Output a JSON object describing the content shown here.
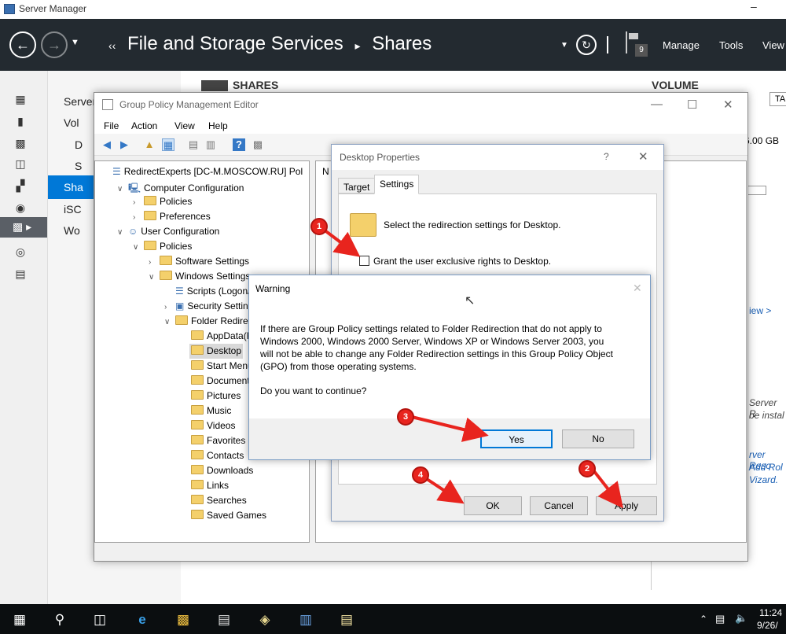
{
  "server_manager": {
    "title": "Server Manager",
    "breadcrumb": [
      "File and Storage Services",
      "Shares"
    ],
    "notification_count": "9",
    "menu": {
      "manage": "Manage",
      "tools": "Tools",
      "view": "View"
    },
    "nav_items": [
      "Server",
      "Vol",
      "D",
      "S",
      "Sha",
      "iSC",
      "Wo"
    ],
    "shares_heading": "SHARES",
    "volume_heading": "VOLUME",
    "volume_tab_label": "TA",
    "volume_size": "6.00 GB",
    "view_link": "iew >",
    "side_text_lines": [
      "Server R",
      "be instal",
      "rver Reso",
      "Add Rol",
      "Vizard."
    ]
  },
  "gpme": {
    "title": "Group Policy Management Editor",
    "menu": [
      "File",
      "Action",
      "View",
      "Help"
    ],
    "right_pane_header": "N",
    "tree": [
      {
        "label": "RedirectExperts [DC-M.MOSCOW.RU] Pol",
        "indent": 0,
        "exp": "",
        "icon": "gpo"
      },
      {
        "label": "Computer Configuration",
        "indent": 1,
        "exp": "v",
        "icon": "computer"
      },
      {
        "label": "Policies",
        "indent": 2,
        "exp": ">",
        "icon": "folder"
      },
      {
        "label": "Preferences",
        "indent": 2,
        "exp": ">",
        "icon": "folder"
      },
      {
        "label": "User Configuration",
        "indent": 1,
        "exp": "v",
        "icon": "user"
      },
      {
        "label": "Policies",
        "indent": 2,
        "exp": "v",
        "icon": "folder"
      },
      {
        "label": "Software Settings",
        "indent": 3,
        "exp": ">",
        "icon": "folder"
      },
      {
        "label": "Windows Settings",
        "indent": 3,
        "exp": "v",
        "icon": "folder"
      },
      {
        "label": "Scripts (Logon/",
        "indent": 4,
        "exp": "",
        "icon": "script"
      },
      {
        "label": "Security Setting",
        "indent": 4,
        "exp": ">",
        "icon": "security"
      },
      {
        "label": "Folder Redirecti",
        "indent": 4,
        "exp": "v",
        "icon": "folder"
      },
      {
        "label": "AppData(Ro",
        "indent": 5,
        "exp": "",
        "icon": "folder"
      },
      {
        "label": "Desktop",
        "indent": 5,
        "exp": "",
        "icon": "folder",
        "selected": true
      },
      {
        "label": "Start Menu",
        "indent": 5,
        "exp": "",
        "icon": "folder"
      },
      {
        "label": "Documents",
        "indent": 5,
        "exp": "",
        "icon": "folder"
      },
      {
        "label": "Pictures",
        "indent": 5,
        "exp": "",
        "icon": "folder"
      },
      {
        "label": "Music",
        "indent": 5,
        "exp": "",
        "icon": "folder"
      },
      {
        "label": "Videos",
        "indent": 5,
        "exp": "",
        "icon": "folder"
      },
      {
        "label": "Favorites",
        "indent": 5,
        "exp": "",
        "icon": "folder"
      },
      {
        "label": "Contacts",
        "indent": 5,
        "exp": "",
        "icon": "folder"
      },
      {
        "label": "Downloads",
        "indent": 5,
        "exp": "",
        "icon": "folder"
      },
      {
        "label": "Links",
        "indent": 5,
        "exp": "",
        "icon": "folder"
      },
      {
        "label": "Searches",
        "indent": 5,
        "exp": "",
        "icon": "folder"
      },
      {
        "label": "Saved Games",
        "indent": 5,
        "exp": "",
        "icon": "folder"
      }
    ]
  },
  "desktop_properties": {
    "title": "Desktop Properties",
    "help": "?",
    "tabs": [
      "Target",
      "Settings"
    ],
    "active_tab": "Settings",
    "description": "Select the redirection settings for Desktop.",
    "option1": "Grant the user exclusive rights to Desktop.",
    "option1_checked": false,
    "buttons": {
      "ok": "OK",
      "cancel": "Cancel",
      "apply": "Apply"
    }
  },
  "warning": {
    "title": "Warning",
    "message": "If there are Group Policy settings related to Folder Redirection that do not apply to Windows 2000, Windows 2000 Server, Windows XP or Windows Server 2003, you will not be able to change any Folder Redirection settings in this Group Policy Object (GPO) from those operating systems.",
    "question": "Do you want to continue?",
    "buttons": {
      "yes": "Yes",
      "no": "No"
    }
  },
  "markers": [
    "1",
    "2",
    "3",
    "4"
  ],
  "taskbar": {
    "time": "11:24",
    "date": "9/26/"
  },
  "colors": {
    "header_bg": "#232a30",
    "marker_red": "#e8241e",
    "selection": "#d9d9d9",
    "accent": "#0078d7"
  }
}
